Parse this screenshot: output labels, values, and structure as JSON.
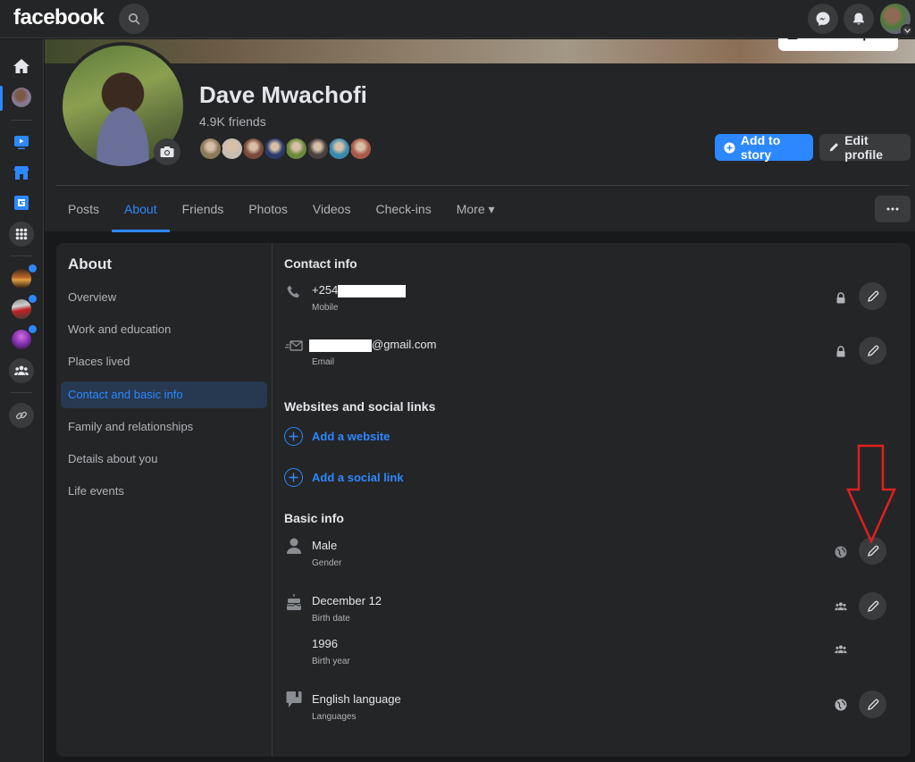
{
  "topbar": {
    "logo": "facebook",
    "icons": [
      "search-icon",
      "messenger-icon",
      "notifications-icon",
      "account-avatar",
      "chevron-down-icon"
    ]
  },
  "rail": {
    "items": [
      {
        "name": "home",
        "icon": "home-icon"
      },
      {
        "name": "profile",
        "icon": "avatar",
        "active": true
      },
      {
        "name": "watch",
        "icon": "watch-icon"
      },
      {
        "name": "marketplace",
        "icon": "marketplace-icon"
      },
      {
        "name": "gaming",
        "icon": "gaming-icon"
      },
      {
        "name": "all-apps",
        "icon": "grid-icon"
      },
      {
        "name": "game-dirt",
        "icon": "game-thumbnail",
        "badge": true
      },
      {
        "name": "game-racing",
        "icon": "game-thumbnail",
        "badge": true
      },
      {
        "name": "game-purple",
        "icon": "game-thumbnail",
        "badge": true
      },
      {
        "name": "groups",
        "icon": "groups-icon"
      },
      {
        "name": "link",
        "icon": "link-icon"
      }
    ]
  },
  "cover": {
    "edit_label": "Edit cover photo"
  },
  "profile": {
    "name": "Dave Mwachofi",
    "friends_count": "4.9K friends",
    "friend_avatar_colors": [
      "#8a7a5a",
      "#c9bcb0",
      "#7a4a3a",
      "#2a3a6a",
      "#6a8a3a",
      "#4a4040",
      "#3a8ab0",
      "#a85a4a"
    ],
    "add_story_label": "Add to story",
    "edit_profile_label": "Edit profile"
  },
  "tabs": [
    {
      "label": "Posts",
      "active": false
    },
    {
      "label": "About",
      "active": true
    },
    {
      "label": "Friends",
      "active": false
    },
    {
      "label": "Photos",
      "active": false
    },
    {
      "label": "Videos",
      "active": false
    },
    {
      "label": "Check-ins",
      "active": false
    },
    {
      "label": "More ▾",
      "active": false
    }
  ],
  "about_nav": {
    "title": "About",
    "items": [
      {
        "label": "Overview",
        "active": false
      },
      {
        "label": "Work and education",
        "active": false
      },
      {
        "label": "Places lived",
        "active": false
      },
      {
        "label": "Contact and basic info",
        "active": true
      },
      {
        "label": "Family and relationships",
        "active": false
      },
      {
        "label": "Details about you",
        "active": false
      },
      {
        "label": "Life events",
        "active": false
      }
    ]
  },
  "contact_info": {
    "title": "Contact info",
    "phone": {
      "value_prefix": "+254",
      "label": "Mobile",
      "privacy": "only-me"
    },
    "email": {
      "value_suffix": "@gmail.com",
      "label": "Email",
      "privacy": "only-me"
    }
  },
  "websites": {
    "title": "Websites and social links",
    "add_website": "Add a website",
    "add_social": "Add a social link"
  },
  "basic_info": {
    "title": "Basic info",
    "gender": {
      "value": "Male",
      "label": "Gender",
      "privacy": "public"
    },
    "birth_date": {
      "value": "December 12",
      "label": "Birth date",
      "privacy": "friends"
    },
    "birth_year": {
      "value": "1996",
      "label": "Birth year",
      "privacy": "friends"
    },
    "language": {
      "value": "English language",
      "label": "Languages",
      "privacy": "public"
    }
  },
  "colors": {
    "accent": "#2d88ff",
    "background": "#18191a",
    "surface": "#242526",
    "annotation": "#e02020"
  }
}
